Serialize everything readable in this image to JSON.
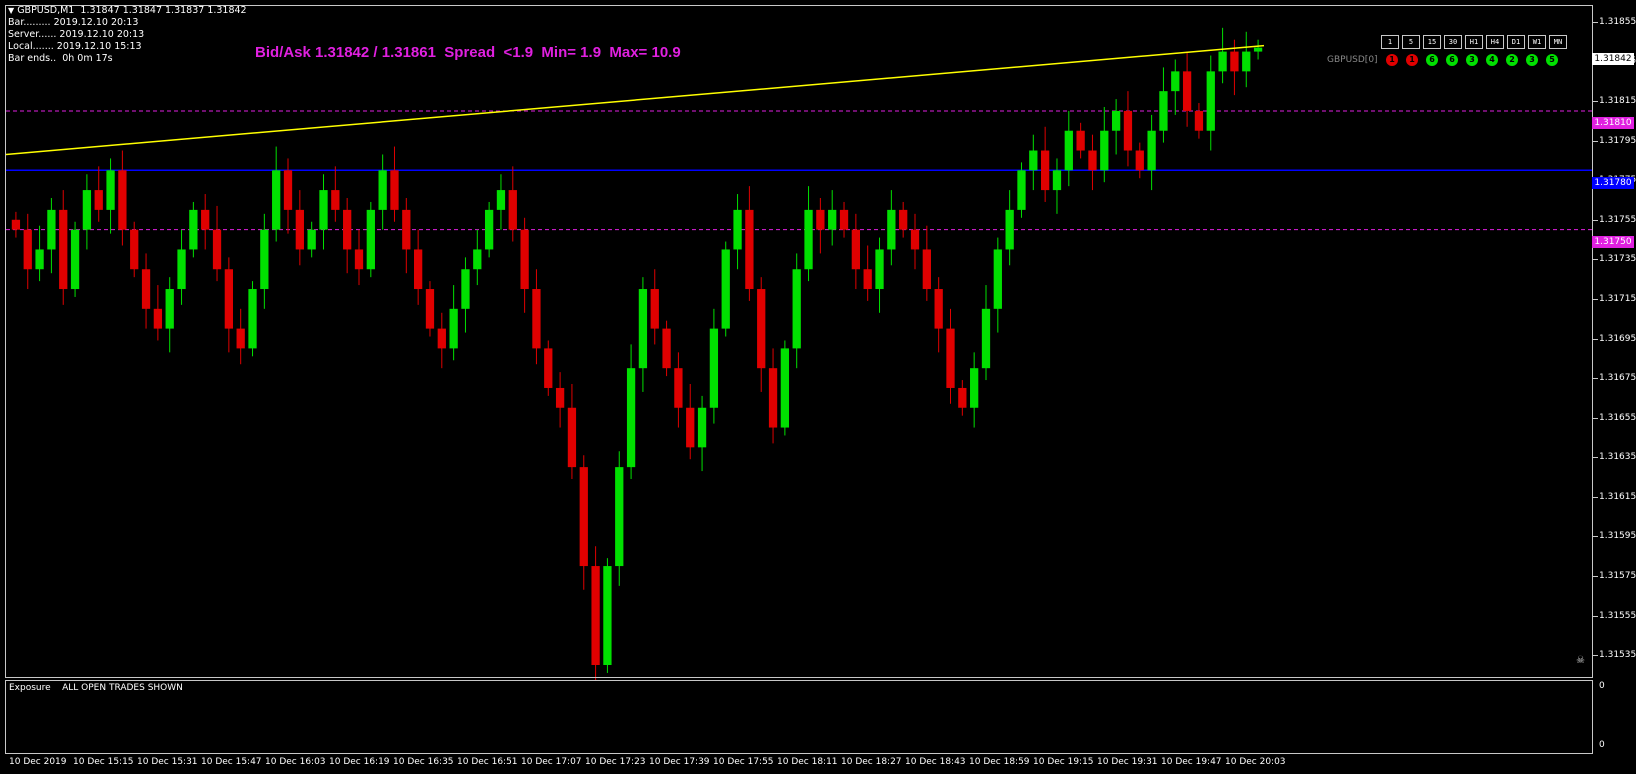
{
  "header": {
    "symbol": "GBPUSD,M1",
    "ohlc": "1.31847 1.31847 1.31837 1.31842",
    "arrow_icon": "triangle-down-icon"
  },
  "info": {
    "bar": "Bar......... 2019.12.10 20:13",
    "server": "Server...... 2019.12.10 20:13",
    "local": "Local....... 2019.12.10 15:13",
    "bar_ends": "Bar ends..  0h 0m 17s"
  },
  "bidask_text": "Bid/Ask 1.31842 / 1.31861  Spread  <1.9  Min= 1.9  Max= 10.9",
  "timeframes": [
    "1",
    "5",
    "15",
    "30",
    "H1",
    "H4",
    "D1",
    "W1",
    "MN"
  ],
  "indicator": {
    "label": "GBPUSD[0]",
    "circles": [
      {
        "text": "1",
        "color": "#e00000"
      },
      {
        "text": "1",
        "color": "#e00000"
      },
      {
        "text": "6",
        "color": "#00e000"
      },
      {
        "text": "6",
        "color": "#00e000"
      },
      {
        "text": "3",
        "color": "#00e000"
      },
      {
        "text": "4",
        "color": "#00e000"
      },
      {
        "text": "2",
        "color": "#00e000"
      },
      {
        "text": "3",
        "color": "#00e000"
      },
      {
        "text": "5",
        "color": "#00e000"
      }
    ]
  },
  "price_axis": {
    "min": 1.3153,
    "max": 1.3186,
    "labels": [
      "1.31855",
      "1.31835",
      "1.31815",
      "1.31795",
      "1.31775",
      "1.31755",
      "1.31735",
      "1.31715",
      "1.31695",
      "1.31675",
      "1.31655",
      "1.31635",
      "1.31615",
      "1.31595",
      "1.31575",
      "1.31555",
      "1.31535"
    ]
  },
  "price_tags": {
    "current": "1.31842",
    "upper": "1.31810",
    "blue": "1.31780",
    "lower": "1.31750"
  },
  "lines": {
    "upper_dashed": 1.3181,
    "blue_level": 1.3178,
    "lower_dashed": 1.3175,
    "trend_start": 1.31788,
    "trend_end": 1.31843
  },
  "colors": {
    "bull": "#00e000",
    "bear": "#e00000",
    "magenta": "#e020e0",
    "blue": "#0000ff",
    "trend": "#ffff00"
  },
  "time_axis": [
    "10 Dec 2019",
    "10 Dec 15:15",
    "10 Dec 15:31",
    "10 Dec 15:47",
    "10 Dec 16:03",
    "10 Dec 16:19",
    "10 Dec 16:35",
    "10 Dec 16:51",
    "10 Dec 17:07",
    "10 Dec 17:23",
    "10 Dec 17:39",
    "10 Dec 17:55",
    "10 Dec 18:11",
    "10 Dec 18:27",
    "10 Dec 18:43",
    "10 Dec 18:59",
    "10 Dec 19:15",
    "10 Dec 19:31",
    "10 Dec 19:47",
    "10 Dec 20:03"
  ],
  "subwindow": {
    "title": "Exposure",
    "message": "ALL OPEN TRADES SHOWN",
    "top_value": "0",
    "bottom_value": "0"
  },
  "chart_data": {
    "type": "candlestick",
    "title": "GBPUSD,M1",
    "closes": [
      1.3175,
      1.3173,
      1.3174,
      1.3176,
      1.3172,
      1.3175,
      1.3177,
      1.3176,
      1.3178,
      1.3175,
      1.3173,
      1.3171,
      1.317,
      1.3172,
      1.3174,
      1.3176,
      1.3175,
      1.3173,
      1.317,
      1.3169,
      1.3172,
      1.3175,
      1.3178,
      1.3176,
      1.3174,
      1.3175,
      1.3177,
      1.3176,
      1.3174,
      1.3173,
      1.3176,
      1.3178,
      1.3176,
      1.3174,
      1.3172,
      1.317,
      1.3169,
      1.3171,
      1.3173,
      1.3174,
      1.3176,
      1.3177,
      1.3175,
      1.3172,
      1.3169,
      1.3167,
      1.3166,
      1.3163,
      1.3158,
      1.3153,
      1.3158,
      1.3163,
      1.3168,
      1.3172,
      1.317,
      1.3168,
      1.3166,
      1.3164,
      1.3166,
      1.317,
      1.3174,
      1.3176,
      1.3172,
      1.3168,
      1.3165,
      1.3169,
      1.3173,
      1.3176,
      1.3175,
      1.3176,
      1.3175,
      1.3173,
      1.3172,
      1.3174,
      1.3176,
      1.3175,
      1.3174,
      1.3172,
      1.317,
      1.3167,
      1.3166,
      1.3168,
      1.3171,
      1.3174,
      1.3176,
      1.3178,
      1.3179,
      1.3177,
      1.3178,
      1.318,
      1.3179,
      1.3178,
      1.318,
      1.3181,
      1.3179,
      1.3178,
      1.318,
      1.3182,
      1.3183,
      1.3181,
      1.318,
      1.3183,
      1.3184,
      1.3183,
      1.3184,
      1.31842
    ]
  }
}
